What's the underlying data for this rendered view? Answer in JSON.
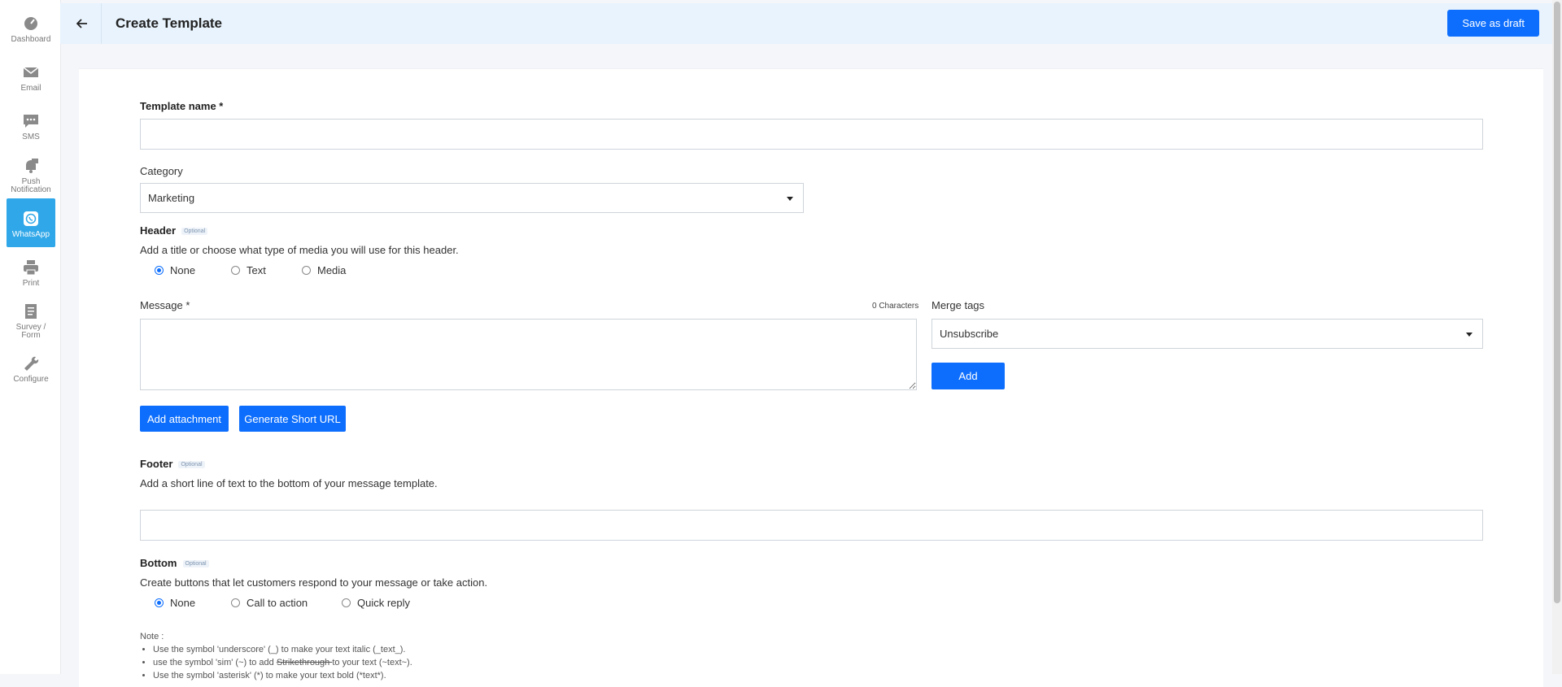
{
  "sidebar": {
    "items": [
      {
        "label": "Dashboard",
        "icon": "dashboard-icon"
      },
      {
        "label": "Email",
        "icon": "envelope-icon"
      },
      {
        "label": "SMS",
        "icon": "chat-icon"
      },
      {
        "label": "Push Notification",
        "icon": "bell-icon"
      },
      {
        "label": "WhatsApp",
        "icon": "whatsapp-icon",
        "active": true
      },
      {
        "label": "Print",
        "icon": "printer-icon"
      },
      {
        "label": "Survey / Form",
        "icon": "clipboard-icon"
      },
      {
        "label": "Configure",
        "icon": "wrench-icon"
      }
    ]
  },
  "header": {
    "title": "Create Template",
    "save_draft": "Save as draft",
    "back_icon": "arrow-left-icon"
  },
  "form": {
    "template_name": {
      "label": "Template name *",
      "value": ""
    },
    "category": {
      "label": "Category",
      "value": "Marketing"
    },
    "header_section": {
      "title": "Header",
      "optional": "Optional",
      "desc": "Add a title or choose what type of media you will use for this header.",
      "options": [
        "None",
        "Text",
        "Media"
      ],
      "selected": "None"
    },
    "message": {
      "label": "Message *",
      "count": "0 Characters",
      "value": ""
    },
    "merge_tags": {
      "label": "Merge tags",
      "value": "Unsubscribe",
      "add": "Add"
    },
    "buttons": {
      "attach": "Add attachment",
      "short_url": "Generate Short URL"
    },
    "footer": {
      "title": "Footer",
      "optional": "Optional",
      "desc": "Add a short line of text to the bottom of your message template.",
      "value": ""
    },
    "bottom": {
      "title": "Bottom",
      "optional": "Optional",
      "desc": "Create buttons that let customers respond to your message or take action.",
      "options": [
        "None",
        "Call to action",
        "Quick reply"
      ],
      "selected": "None"
    }
  },
  "note": {
    "title": "Note :",
    "line1": "Use the symbol 'underscore' (_) to make your text italic (_text_).",
    "line2_pre": "use the symbol 'sim' (~) to add ",
    "line2_strike": "Strikethrough ",
    "line2_post": "to your text (~text~).",
    "line3": "Use the symbol 'asterisk' (*) to make your text bold (*text*)."
  },
  "colors": {
    "primary": "#0d6efd",
    "active_nav": "#2fa7e8",
    "topbar": "#e8f3fd"
  }
}
